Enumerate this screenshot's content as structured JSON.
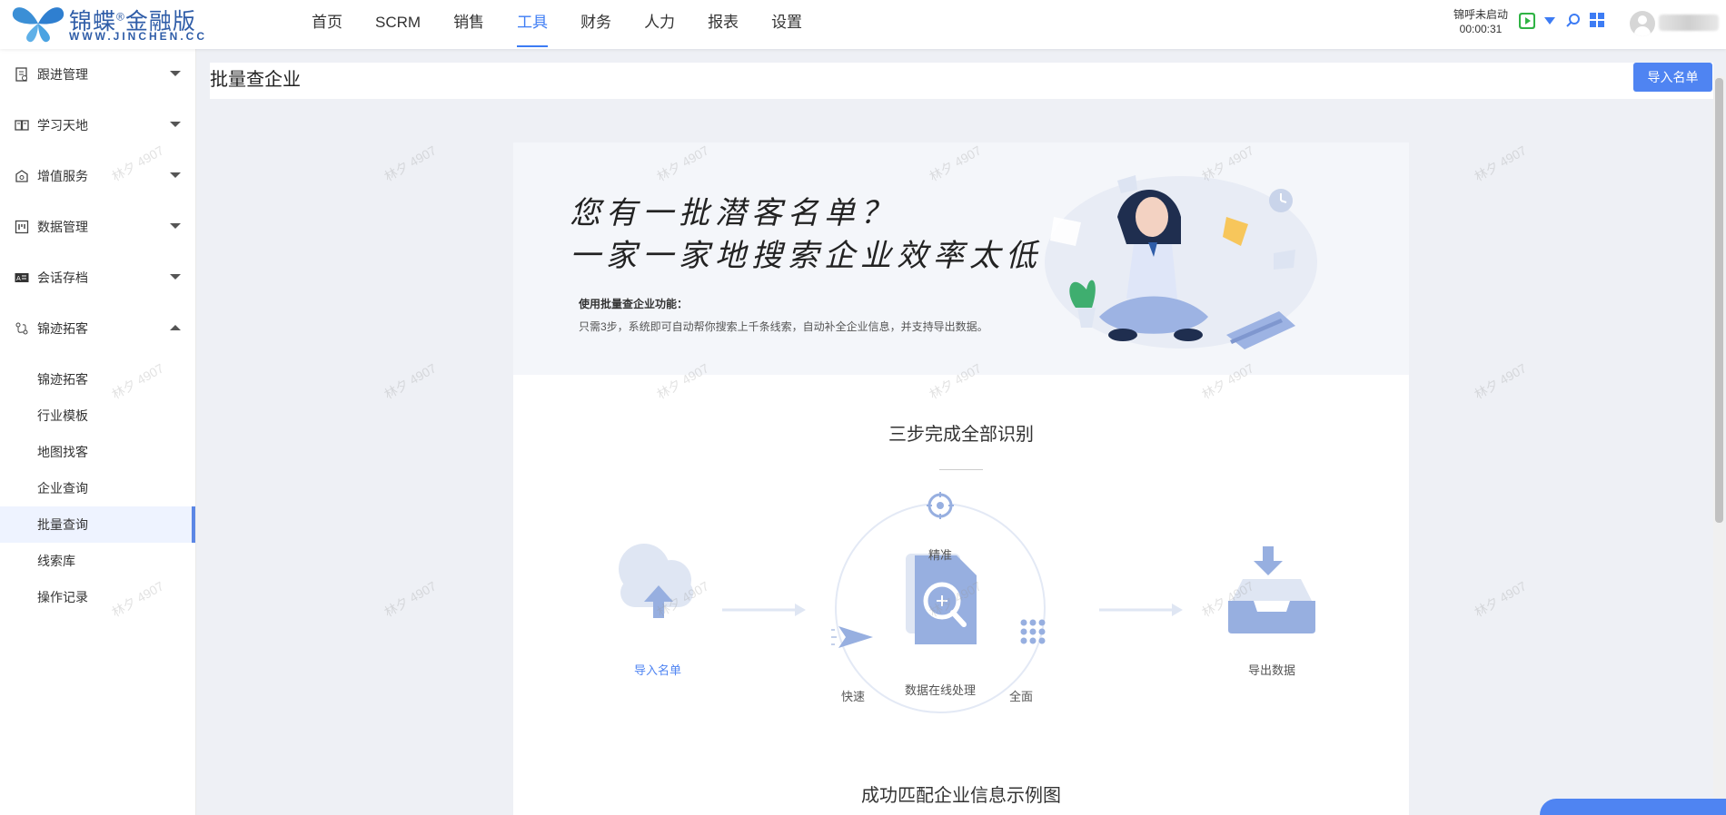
{
  "brand": {
    "name": "锦蝶",
    "registered": "®",
    "edition": "金融版",
    "url": "WWW.JINCHEN.CC"
  },
  "nav": {
    "items": [
      "首页",
      "SCRM",
      "销售",
      "工具",
      "财务",
      "人力",
      "报表",
      "设置"
    ],
    "active": "工具"
  },
  "call": {
    "status": "锦呼未启动",
    "timer": "00:00:31"
  },
  "sidebar": {
    "groups": [
      {
        "label": "跟进管理",
        "icon": "clipboard-icon",
        "expanded": false
      },
      {
        "label": "学习天地",
        "icon": "book-icon",
        "expanded": false
      },
      {
        "label": "增值服务",
        "icon": "gift-icon",
        "expanded": false
      },
      {
        "label": "数据管理",
        "icon": "chart-icon",
        "expanded": false
      },
      {
        "label": "会话存档",
        "icon": "id-card-icon",
        "expanded": false
      },
      {
        "label": "锦迹拓客",
        "icon": "route-icon",
        "expanded": true
      }
    ],
    "sub_items": [
      "锦迹拓客",
      "行业模板",
      "地图找客",
      "企业查询",
      "批量查询",
      "线索库",
      "操作记录"
    ],
    "active_sub": "批量查询"
  },
  "page": {
    "title": "批量查企业",
    "import_button": "导入名单"
  },
  "hero": {
    "line1": "您有一批潜客名单？",
    "line2": "一家一家地搜索企业效率太低？",
    "feature_title": "使用批量查企业功能：",
    "feature_desc": "只需3步，系统即可自动帮你搜索上千条线索，自动补全企业信息，并支持导出数据。"
  },
  "steps": {
    "title": "三步完成全部识别",
    "step1": "导入名单",
    "center": "数据在线处理",
    "precise": "精准",
    "fast": "快速",
    "full": "全面",
    "step3": "导出数据"
  },
  "example_title": "成功匹配企业信息示例图",
  "watermark": "林夕 4907",
  "colors": {
    "accent": "#4f84f2",
    "illustration": "#97afe0",
    "illustration_light": "#dfe6f3"
  }
}
